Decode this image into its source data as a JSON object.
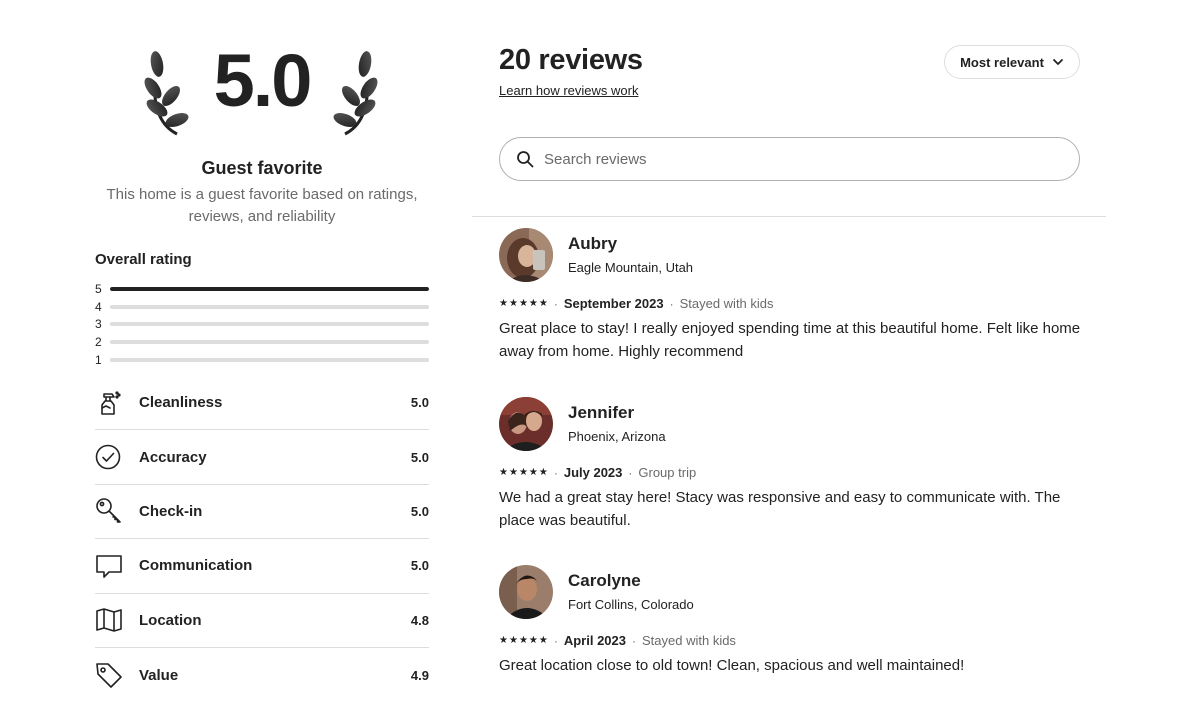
{
  "hero": {
    "score": "5.0",
    "title": "Guest favorite",
    "subtitle": "This home is a guest favorite based on ratings, reviews, and reliability"
  },
  "overall": {
    "title": "Overall rating",
    "distribution": [
      {
        "stars": "5",
        "fraction": 1.0
      },
      {
        "stars": "4",
        "fraction": 0.0
      },
      {
        "stars": "3",
        "fraction": 0.0
      },
      {
        "stars": "2",
        "fraction": 0.0
      },
      {
        "stars": "1",
        "fraction": 0.0
      }
    ]
  },
  "categories": [
    {
      "label": "Cleanliness",
      "value": "5.0",
      "icon": "spray-bottle-icon"
    },
    {
      "label": "Accuracy",
      "value": "5.0",
      "icon": "check-circle-icon"
    },
    {
      "label": "Check-in",
      "value": "5.0",
      "icon": "key-icon"
    },
    {
      "label": "Communication",
      "value": "5.0",
      "icon": "chat-bubble-icon"
    },
    {
      "label": "Location",
      "value": "4.8",
      "icon": "map-icon"
    },
    {
      "label": "Value",
      "value": "4.9",
      "icon": "tag-icon"
    }
  ],
  "reviews_header": {
    "title": "20 reviews",
    "learn_link": "Learn how reviews work",
    "sort_label": "Most relevant",
    "search_placeholder": "Search reviews"
  },
  "reviews": [
    {
      "name": "Aubry",
      "location": "Eagle Mountain, Utah",
      "rating": 5,
      "date": "September 2023",
      "trip": "Stayed with kids",
      "text": "Great place to stay! I really enjoyed spending time at this beautiful home. Felt like home away from home. Highly recommend"
    },
    {
      "name": "Jennifer",
      "location": "Phoenix, Arizona",
      "rating": 5,
      "date": "July 2023",
      "trip": "Group trip",
      "text": "We had a great stay here! Stacy was responsive and easy to communicate with. The place was beautiful."
    },
    {
      "name": "Carolyne",
      "location": "Fort Collins, Colorado",
      "rating": 5,
      "date": "April 2023",
      "trip": "Stayed with kids",
      "text": "Great location close to old town! Clean, spacious and well maintained!"
    }
  ],
  "colors": {
    "text": "#222222",
    "muted": "#6a6a6a",
    "divider": "#dddddd",
    "bar_fill": "#222222",
    "bar_track": "#dddddd"
  }
}
